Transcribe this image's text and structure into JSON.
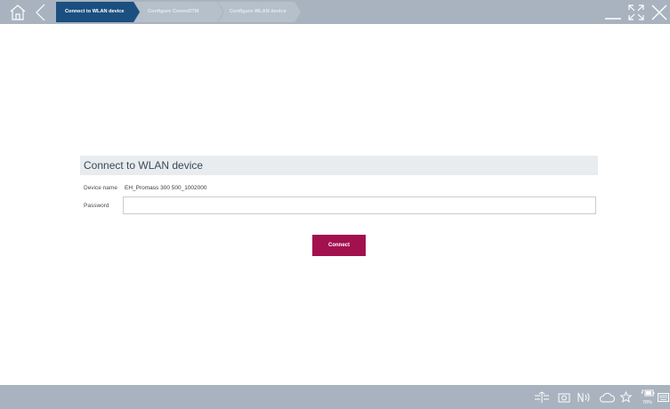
{
  "toolbar": {
    "home_icon": "home-icon",
    "back_icon": "back-arrow-icon",
    "minimize_icon": "minimize-icon",
    "fullscreen_icon": "fullscreen-icon",
    "close_icon": "close-icon"
  },
  "breadcrumb": {
    "steps": [
      {
        "label": "Connect to WLAN device",
        "active": true
      },
      {
        "label": "Configure CommDTM",
        "active": false
      },
      {
        "label": "Configure WLAN device",
        "active": false
      }
    ]
  },
  "form": {
    "title": "Connect to WLAN device",
    "device_name_label": "Device name",
    "device_name_value": "EH_Promass 300 500_1002000",
    "password_label": "Password",
    "password_value": "",
    "connect_label": "Connect"
  },
  "taskbar": {
    "icons": [
      "network-icon",
      "camera-icon",
      "nfc-icon",
      "cloud-icon",
      "star-icon",
      "battery-icon",
      "keyboard-icon"
    ],
    "battery_percent": "78%"
  },
  "colors": {
    "bar": "#a8b3bf",
    "active_step": "#1a4f80",
    "accent": "#a2114e"
  }
}
